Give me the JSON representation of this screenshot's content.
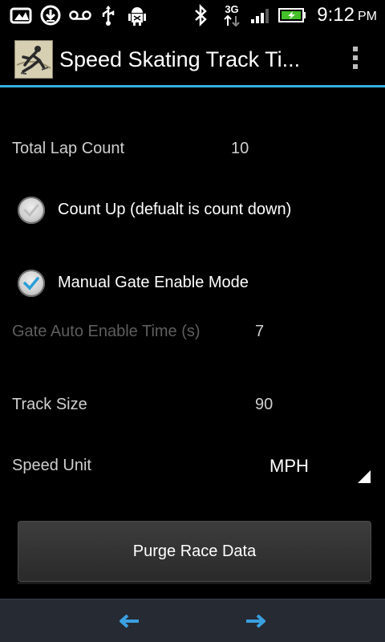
{
  "status_bar": {
    "icons": [
      "picture-icon",
      "download-icon",
      "voicemail-icon",
      "usb-icon",
      "android-debug-icon",
      "bluetooth-icon",
      "3g-data-icon",
      "signal-icon",
      "battery-charging-icon"
    ],
    "network_type": "3G",
    "time": "9:12",
    "ampm": "PM"
  },
  "action_bar": {
    "title": "Speed Skating Track Ti...",
    "app_icon": "speed-skater-logo",
    "overflow_icon": "overflow-menu-icon",
    "accent_color": "#34b0e0"
  },
  "settings": {
    "total_lap_count": {
      "label": "Total Lap Count",
      "value": "10"
    },
    "count_up": {
      "label": "Count Up (defualt is count down)",
      "checked": false
    },
    "manual_gate": {
      "label": "Manual Gate Enable Mode",
      "checked": true
    },
    "gate_auto_enable_time": {
      "label": "Gate Auto Enable Time (s)",
      "value": "7",
      "enabled": false
    },
    "track_size": {
      "label": "Track Size",
      "value": "90"
    },
    "speed_unit": {
      "label": "Speed Unit",
      "value": "MPH"
    }
  },
  "buttons": {
    "purge": "Purge Race Data"
  },
  "bottom_nav": {
    "back_icon": "arrow-left-icon",
    "forward_icon": "arrow-right-icon",
    "arrow_color": "#3aa0e0"
  }
}
